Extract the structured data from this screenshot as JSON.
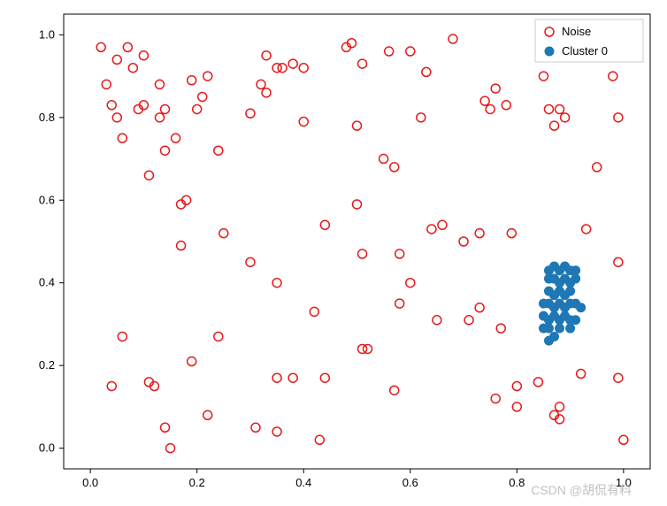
{
  "chart_data": {
    "type": "scatter",
    "title": "",
    "xlabel": "",
    "ylabel": "",
    "xlim": [
      -0.05,
      1.05
    ],
    "ylim": [
      -0.05,
      1.05
    ],
    "xticks": [
      0.0,
      0.2,
      0.4,
      0.6,
      0.8,
      1.0
    ],
    "yticks": [
      0.0,
      0.2,
      0.4,
      0.6,
      0.8,
      1.0
    ],
    "legend_position": "upper right",
    "series": [
      {
        "name": "Noise",
        "marker": "open-circle",
        "color": "#e41a1c",
        "points": [
          {
            "x": 0.02,
            "y": 0.97
          },
          {
            "x": 0.03,
            "y": 0.88
          },
          {
            "x": 0.05,
            "y": 0.94
          },
          {
            "x": 0.07,
            "y": 0.97
          },
          {
            "x": 0.04,
            "y": 0.83
          },
          {
            "x": 0.05,
            "y": 0.8
          },
          {
            "x": 0.06,
            "y": 0.75
          },
          {
            "x": 0.08,
            "y": 0.92
          },
          {
            "x": 0.1,
            "y": 0.95
          },
          {
            "x": 0.09,
            "y": 0.82
          },
          {
            "x": 0.1,
            "y": 0.83
          },
          {
            "x": 0.11,
            "y": 0.66
          },
          {
            "x": 0.13,
            "y": 0.88
          },
          {
            "x": 0.13,
            "y": 0.8
          },
          {
            "x": 0.14,
            "y": 0.82
          },
          {
            "x": 0.14,
            "y": 0.72
          },
          {
            "x": 0.16,
            "y": 0.75
          },
          {
            "x": 0.17,
            "y": 0.59
          },
          {
            "x": 0.18,
            "y": 0.6
          },
          {
            "x": 0.19,
            "y": 0.89
          },
          {
            "x": 0.2,
            "y": 0.82
          },
          {
            "x": 0.21,
            "y": 0.85
          },
          {
            "x": 0.22,
            "y": 0.9
          },
          {
            "x": 0.24,
            "y": 0.72
          },
          {
            "x": 0.04,
            "y": 0.15
          },
          {
            "x": 0.06,
            "y": 0.27
          },
          {
            "x": 0.11,
            "y": 0.16
          },
          {
            "x": 0.12,
            "y": 0.15
          },
          {
            "x": 0.14,
            "y": 0.05
          },
          {
            "x": 0.15,
            "y": 0.0
          },
          {
            "x": 0.17,
            "y": 0.49
          },
          {
            "x": 0.19,
            "y": 0.21
          },
          {
            "x": 0.22,
            "y": 0.08
          },
          {
            "x": 0.24,
            "y": 0.27
          },
          {
            "x": 0.25,
            "y": 0.52
          },
          {
            "x": 0.3,
            "y": 0.81
          },
          {
            "x": 0.32,
            "y": 0.88
          },
          {
            "x": 0.33,
            "y": 0.86
          },
          {
            "x": 0.33,
            "y": 0.95
          },
          {
            "x": 0.35,
            "y": 0.92
          },
          {
            "x": 0.36,
            "y": 0.92
          },
          {
            "x": 0.38,
            "y": 0.93
          },
          {
            "x": 0.4,
            "y": 0.92
          },
          {
            "x": 0.4,
            "y": 0.79
          },
          {
            "x": 0.3,
            "y": 0.45
          },
          {
            "x": 0.35,
            "y": 0.4
          },
          {
            "x": 0.38,
            "y": 0.17
          },
          {
            "x": 0.35,
            "y": 0.17
          },
          {
            "x": 0.35,
            "y": 0.04
          },
          {
            "x": 0.31,
            "y": 0.05
          },
          {
            "x": 0.42,
            "y": 0.33
          },
          {
            "x": 0.44,
            "y": 0.54
          },
          {
            "x": 0.44,
            "y": 0.17
          },
          {
            "x": 0.43,
            "y": 0.02
          },
          {
            "x": 0.48,
            "y": 0.97
          },
          {
            "x": 0.49,
            "y": 0.98
          },
          {
            "x": 0.51,
            "y": 0.93
          },
          {
            "x": 0.5,
            "y": 0.78
          },
          {
            "x": 0.5,
            "y": 0.59
          },
          {
            "x": 0.51,
            "y": 0.47
          },
          {
            "x": 0.51,
            "y": 0.24
          },
          {
            "x": 0.52,
            "y": 0.24
          },
          {
            "x": 0.56,
            "y": 0.96
          },
          {
            "x": 0.57,
            "y": 0.68
          },
          {
            "x": 0.55,
            "y": 0.7
          },
          {
            "x": 0.58,
            "y": 0.47
          },
          {
            "x": 0.58,
            "y": 0.35
          },
          {
            "x": 0.57,
            "y": 0.14
          },
          {
            "x": 0.6,
            "y": 0.96
          },
          {
            "x": 0.6,
            "y": 0.4
          },
          {
            "x": 0.62,
            "y": 0.8
          },
          {
            "x": 0.63,
            "y": 0.91
          },
          {
            "x": 0.64,
            "y": 0.53
          },
          {
            "x": 0.65,
            "y": 0.31
          },
          {
            "x": 0.66,
            "y": 0.54
          },
          {
            "x": 0.68,
            "y": 0.99
          },
          {
            "x": 0.7,
            "y": 0.5
          },
          {
            "x": 0.71,
            "y": 0.31
          },
          {
            "x": 0.73,
            "y": 0.52
          },
          {
            "x": 0.74,
            "y": 0.84
          },
          {
            "x": 0.75,
            "y": 0.82
          },
          {
            "x": 0.76,
            "y": 0.87
          },
          {
            "x": 0.78,
            "y": 0.83
          },
          {
            "x": 0.79,
            "y": 0.52
          },
          {
            "x": 0.73,
            "y": 0.34
          },
          {
            "x": 0.77,
            "y": 0.29
          },
          {
            "x": 0.76,
            "y": 0.12
          },
          {
            "x": 0.8,
            "y": 0.1
          },
          {
            "x": 0.8,
            "y": 0.15
          },
          {
            "x": 0.84,
            "y": 0.16
          },
          {
            "x": 0.85,
            "y": 0.9
          },
          {
            "x": 0.86,
            "y": 0.82
          },
          {
            "x": 0.87,
            "y": 0.78
          },
          {
            "x": 0.88,
            "y": 0.82
          },
          {
            "x": 0.89,
            "y": 0.8
          },
          {
            "x": 0.87,
            "y": 0.08
          },
          {
            "x": 0.88,
            "y": 0.1
          },
          {
            "x": 0.88,
            "y": 0.07
          },
          {
            "x": 0.92,
            "y": 0.18
          },
          {
            "x": 0.93,
            "y": 0.53
          },
          {
            "x": 0.95,
            "y": 0.68
          },
          {
            "x": 0.98,
            "y": 0.9
          },
          {
            "x": 0.99,
            "y": 0.8
          },
          {
            "x": 0.99,
            "y": 0.45
          },
          {
            "x": 0.99,
            "y": 0.17
          },
          {
            "x": 1.0,
            "y": 0.02
          }
        ]
      },
      {
        "name": "Cluster 0",
        "marker": "filled-circle",
        "color": "#1f77b4",
        "points": [
          {
            "x": 0.86,
            "y": 0.43
          },
          {
            "x": 0.87,
            "y": 0.44
          },
          {
            "x": 0.88,
            "y": 0.43
          },
          {
            "x": 0.89,
            "y": 0.44
          },
          {
            "x": 0.9,
            "y": 0.43
          },
          {
            "x": 0.91,
            "y": 0.43
          },
          {
            "x": 0.86,
            "y": 0.41
          },
          {
            "x": 0.87,
            "y": 0.41
          },
          {
            "x": 0.88,
            "y": 0.4
          },
          {
            "x": 0.89,
            "y": 0.41
          },
          {
            "x": 0.9,
            "y": 0.4
          },
          {
            "x": 0.91,
            "y": 0.41
          },
          {
            "x": 0.86,
            "y": 0.38
          },
          {
            "x": 0.87,
            "y": 0.37
          },
          {
            "x": 0.88,
            "y": 0.38
          },
          {
            "x": 0.89,
            "y": 0.37
          },
          {
            "x": 0.9,
            "y": 0.38
          },
          {
            "x": 0.85,
            "y": 0.35
          },
          {
            "x": 0.86,
            "y": 0.35
          },
          {
            "x": 0.87,
            "y": 0.34
          },
          {
            "x": 0.88,
            "y": 0.35
          },
          {
            "x": 0.89,
            "y": 0.34
          },
          {
            "x": 0.9,
            "y": 0.35
          },
          {
            "x": 0.91,
            "y": 0.35
          },
          {
            "x": 0.92,
            "y": 0.34
          },
          {
            "x": 0.85,
            "y": 0.32
          },
          {
            "x": 0.86,
            "y": 0.31
          },
          {
            "x": 0.87,
            "y": 0.32
          },
          {
            "x": 0.88,
            "y": 0.31
          },
          {
            "x": 0.89,
            "y": 0.32
          },
          {
            "x": 0.9,
            "y": 0.31
          },
          {
            "x": 0.91,
            "y": 0.31
          },
          {
            "x": 0.85,
            "y": 0.29
          },
          {
            "x": 0.86,
            "y": 0.29
          },
          {
            "x": 0.88,
            "y": 0.29
          },
          {
            "x": 0.9,
            "y": 0.29
          },
          {
            "x": 0.87,
            "y": 0.27
          },
          {
            "x": 0.86,
            "y": 0.26
          }
        ]
      }
    ]
  },
  "xtick_labels": [
    "0.0",
    "0.2",
    "0.4",
    "0.6",
    "0.8",
    "1.0"
  ],
  "ytick_labels": [
    "0.0",
    "0.2",
    "0.4",
    "0.6",
    "0.8",
    "1.0"
  ],
  "legend": {
    "items": [
      {
        "label": "Noise"
      },
      {
        "label": "Cluster 0"
      }
    ]
  },
  "watermark": "CSDN @胡侃有料"
}
